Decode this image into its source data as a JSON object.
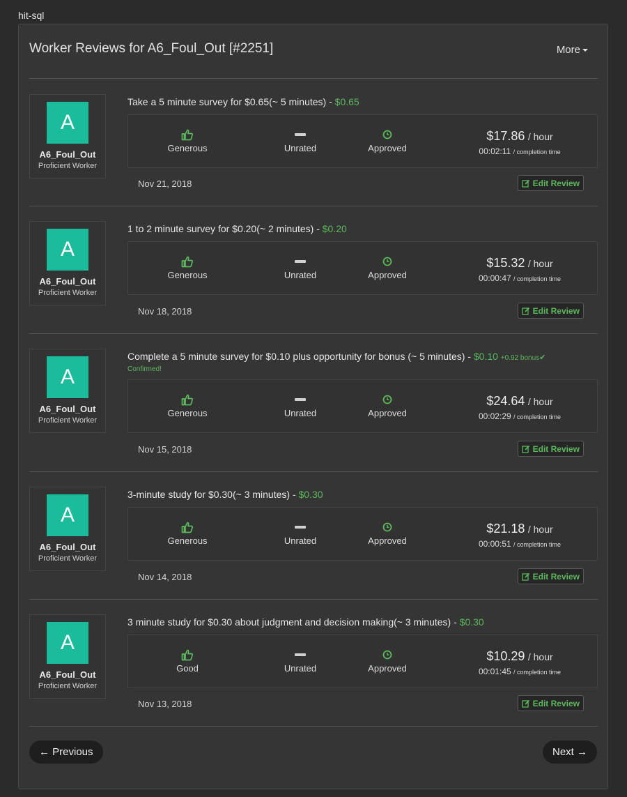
{
  "app": {
    "label": "hit-sql"
  },
  "header": {
    "title": "Worker Reviews for A6_Foul_Out [#2251]",
    "more_label": "More"
  },
  "icons": {
    "thumb": "thumbs-up-icon",
    "clock": "clock-icon",
    "edit": "edit-icon",
    "dash": "dash-icon"
  },
  "colors": {
    "accent": "#5cb85c",
    "avatar": "#1abc9c",
    "background": "#2b2b2b"
  },
  "reviews": [
    {
      "avatar_letter": "A",
      "worker_name": "A6_Foul_Out",
      "worker_level": "Proficient Worker",
      "title": "Take a 5 minute survey for $0.65(~ 5 minutes)",
      "separator": " - ",
      "reward": "$0.65",
      "generosity": "Generous",
      "pending": "Unrated",
      "status": "Approved",
      "hourly": "$17.86",
      "hourly_unit": "/ hour",
      "completion": "00:02:11",
      "completion_label": "/ completion time",
      "date": "Nov 21, 2018",
      "edit_label": "Edit Review"
    },
    {
      "avatar_letter": "A",
      "worker_name": "A6_Foul_Out",
      "worker_level": "Proficient Worker",
      "title": "1 to 2 minute survey for $0.20(~ 2 minutes)",
      "separator": " - ",
      "reward": "$0.20",
      "generosity": "Generous",
      "pending": "Unrated",
      "status": "Approved",
      "hourly": "$15.32",
      "hourly_unit": "/ hour",
      "completion": "00:00:47",
      "completion_label": "/ completion time",
      "date": "Nov 18, 2018",
      "edit_label": "Edit Review"
    },
    {
      "avatar_letter": "A",
      "worker_name": "A6_Foul_Out",
      "worker_level": "Proficient Worker",
      "title": "Complete a 5 minute survey for $0.10 plus opportunity for bonus (~ 5 minutes)",
      "separator": " - ",
      "reward": "$0.10",
      "bonus": "+0.92 bonus",
      "bonus_status": "Confirmed!",
      "generosity": "Generous",
      "pending": "Unrated",
      "status": "Approved",
      "hourly": "$24.64",
      "hourly_unit": "/ hour",
      "completion": "00:02:29",
      "completion_label": "/ completion time",
      "date": "Nov 15, 2018",
      "edit_label": "Edit Review"
    },
    {
      "avatar_letter": "A",
      "worker_name": "A6_Foul_Out",
      "worker_level": "Proficient Worker",
      "title": "3-minute study for $0.30(~ 3 minutes)",
      "separator": " - ",
      "reward": "$0.30",
      "generosity": "Generous",
      "pending": "Unrated",
      "status": "Approved",
      "hourly": "$21.18",
      "hourly_unit": "/ hour",
      "completion": "00:00:51",
      "completion_label": "/ completion time",
      "date": "Nov 14, 2018",
      "edit_label": "Edit Review"
    },
    {
      "avatar_letter": "A",
      "worker_name": "A6_Foul_Out",
      "worker_level": "Proficient Worker",
      "title": "3 minute study for $0.30 about judgment and decision making(~ 3 minutes)",
      "separator": " - ",
      "reward": "$0.30",
      "generosity": "Good",
      "pending": "Unrated",
      "status": "Approved",
      "hourly": "$10.29",
      "hourly_unit": "/ hour",
      "completion": "00:01:45",
      "completion_label": "/ completion time",
      "date": "Nov 13, 2018",
      "edit_label": "Edit Review"
    }
  ],
  "pagination": {
    "previous_label": "← Previous",
    "next_label": "Next →"
  }
}
